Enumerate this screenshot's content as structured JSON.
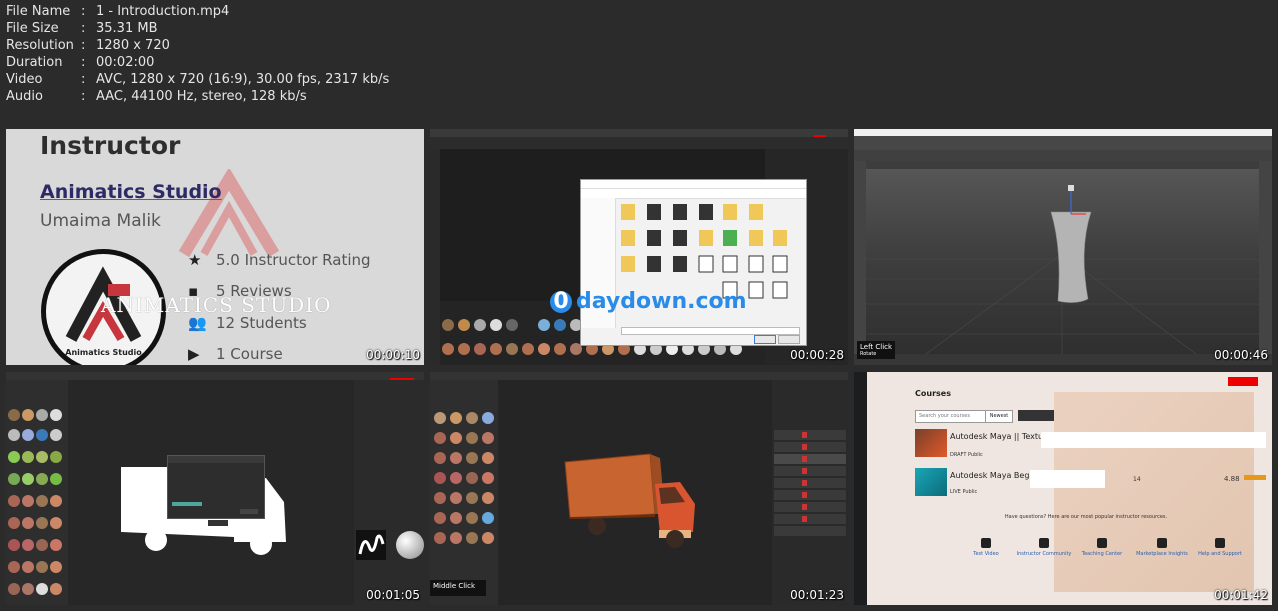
{
  "meta": {
    "rows": [
      {
        "key": "File Name",
        "value": "1 - Introduction.mp4"
      },
      {
        "key": "File Size",
        "value": "35.31 MB"
      },
      {
        "key": "Resolution",
        "value": "1280 x 720"
      },
      {
        "key": "Duration",
        "value": "00:02:00"
      },
      {
        "key": "Video",
        "value": "AVC, 1280 x 720 (16:9), 30.00 fps, 2317 kb/s"
      },
      {
        "key": "Audio",
        "value": "AAC, 44100 Hz, stereo, 128 kb/s"
      }
    ],
    "separator": ":"
  },
  "thumbs": [
    {
      "timestamp": "00:00:10"
    },
    {
      "timestamp": "00:00:28"
    },
    {
      "timestamp": "00:00:46"
    },
    {
      "timestamp": "00:01:05"
    },
    {
      "timestamp": "00:01:23"
    },
    {
      "timestamp": "00:01:42"
    }
  ],
  "instructor": {
    "heading": "Instructor",
    "studio": "Animatics Studio",
    "name": "Umaima Malik",
    "logo_text": "Animatics Studio",
    "watermark": "ANIMATICS STUDIO",
    "stats": [
      {
        "icon": "★",
        "label": "5.0 Instructor Rating"
      },
      {
        "icon": "▪",
        "label": "5 Reviews"
      },
      {
        "icon": "👥",
        "label": "12 Students"
      },
      {
        "icon": "▶",
        "label": "1 Course"
      }
    ]
  },
  "watermark": {
    "text": "daydown.com",
    "prefix": "0"
  },
  "maya": {
    "tip_title": "Left Click",
    "tip_sub": "Rotate"
  },
  "painter1": {
    "tip_title": "Middle Click"
  },
  "courses": {
    "heading": "Courses",
    "search_placeholder": "Search your courses",
    "sort_label": "Newest",
    "items": [
      {
        "title": "Autodesk Maya || Textures Baking",
        "state": "DRAFT",
        "type": "Public"
      },
      {
        "title": "Autodesk Maya Beginner's Course",
        "state": "LIVE",
        "type": "Public",
        "students": "14",
        "rating": "4.88"
      }
    ],
    "footer_prompt": "Have questions? Here are our most popular instructor resources.",
    "footer": [
      {
        "label": "Test Video"
      },
      {
        "label": "Instructor Community"
      },
      {
        "label": "Teaching Center"
      },
      {
        "label": "Marketplace Insights"
      },
      {
        "label": "Help and Support"
      }
    ]
  }
}
